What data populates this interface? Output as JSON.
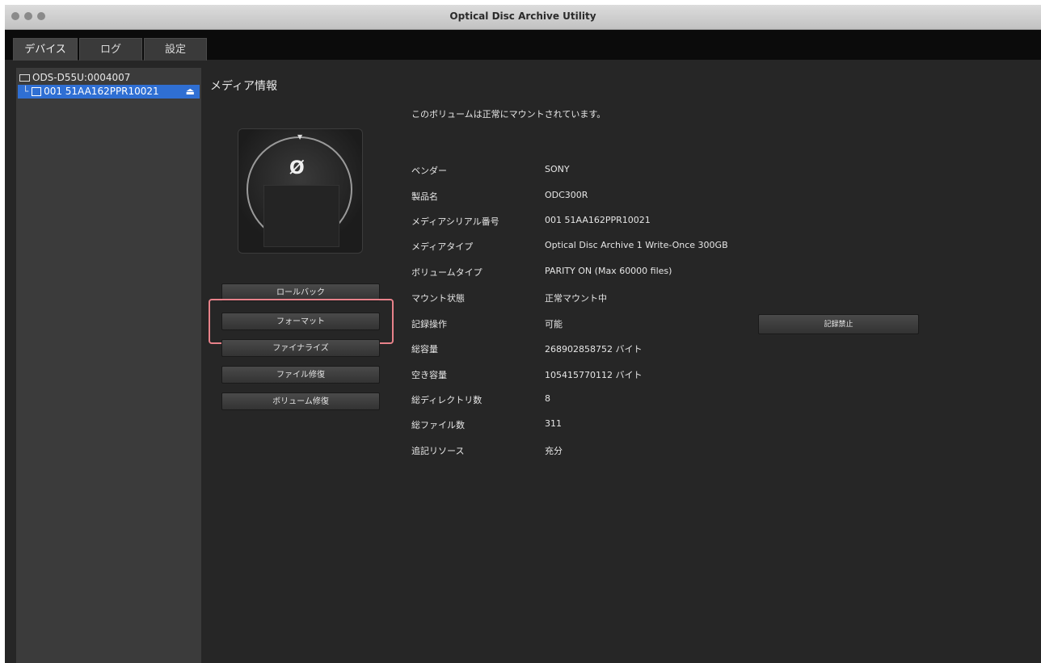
{
  "window": {
    "title": "Optical Disc Archive Utility"
  },
  "tabs": [
    {
      "label": "デバイス"
    },
    {
      "label": "ログ"
    },
    {
      "label": "設定"
    }
  ],
  "sidebar": {
    "device": "ODS-D55U:0004007",
    "media": "001 51AA162PPR10021"
  },
  "panel": {
    "title": "メディア情報",
    "status_message": "このボリュームは正常にマウントされています。"
  },
  "actions": {
    "roll_back": "ロールバック",
    "format": "フォーマット",
    "finalize": "ファイナライズ",
    "file_repair": "ファイル修復",
    "volume_repair": "ボリューム修復"
  },
  "info": [
    {
      "label": "ベンダー",
      "value": "SONY"
    },
    {
      "label": "製品名",
      "value": "ODC300R"
    },
    {
      "label": "メディアシリアル番号",
      "value": "001 51AA162PPR10021"
    },
    {
      "label": "メディアタイプ",
      "value": "Optical Disc Archive 1 Write-Once 300GB"
    },
    {
      "label": "ボリュームタイプ",
      "value": "PARITY ON (Max 60000 files)"
    },
    {
      "label": "マウント状態",
      "value": "正常マウント中"
    },
    {
      "label": "記録操作",
      "value": "可能"
    },
    {
      "label": "総容量",
      "value": "268902858752 バイト"
    },
    {
      "label": "空き容量",
      "value": "105415770112 バイト"
    },
    {
      "label": "総ディレクトリ数",
      "value": "8"
    },
    {
      "label": "総ファイル数",
      "value": "311"
    },
    {
      "label": "追記リソース",
      "value": "充分"
    }
  ],
  "record_stop_button": "記録禁止"
}
